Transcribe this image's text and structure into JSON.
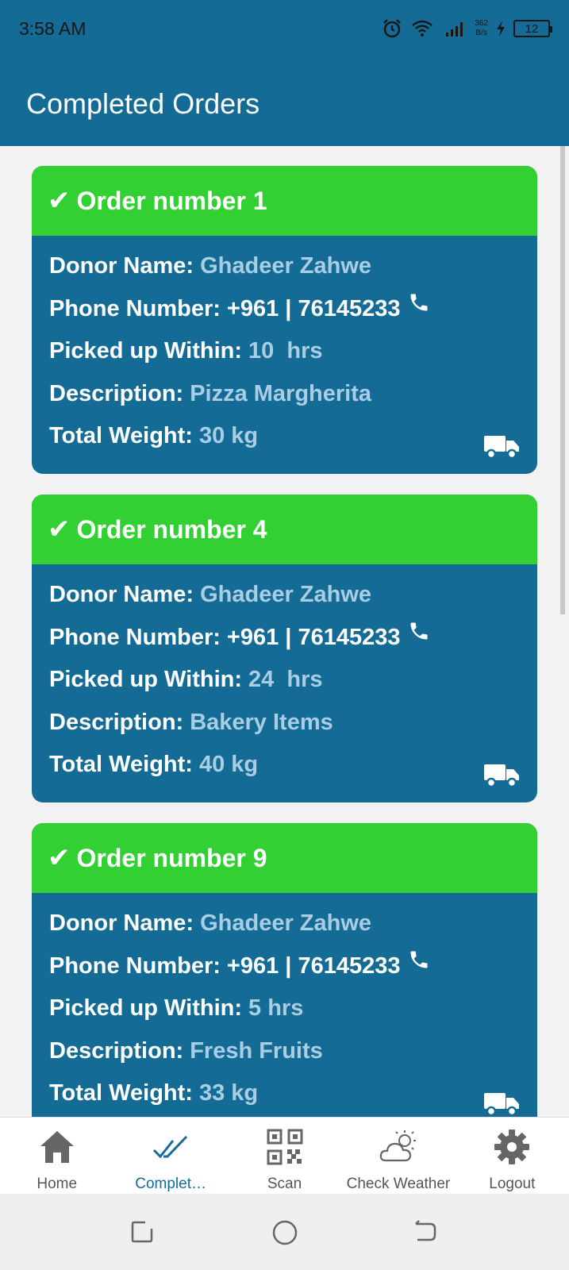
{
  "status_bar": {
    "time": "3:58 AM",
    "net_speed_value": "362",
    "net_speed_unit": "B/s",
    "battery": "12"
  },
  "header": {
    "title": "Completed Orders"
  },
  "orders": [
    {
      "title": "Order number 1",
      "donor_label": "Donor Name:",
      "donor": "Ghadeer Zahwe",
      "phone_label": "Phone Number:",
      "phone": "+961 | 76145233",
      "pickup_label": "Picked up Within:",
      "pickup": "10  hrs",
      "desc_label": "Description:",
      "desc": "Pizza Margherita",
      "weight_label": "Total Weight:",
      "weight": "30 kg"
    },
    {
      "title": "Order number 4",
      "donor_label": "Donor Name:",
      "donor": "Ghadeer Zahwe",
      "phone_label": "Phone Number:",
      "phone": "+961 | 76145233",
      "pickup_label": "Picked up Within:",
      "pickup": "24  hrs",
      "desc_label": "Description:",
      "desc": "Bakery Items",
      "weight_label": "Total Weight:",
      "weight": "40 kg"
    },
    {
      "title": "Order number 9",
      "donor_label": "Donor Name:",
      "donor": "Ghadeer Zahwe",
      "phone_label": "Phone Number:",
      "phone": "+961 | 76145233",
      "pickup_label": "Picked up Within:",
      "pickup": "5 hrs",
      "desc_label": "Description:",
      "desc": "Fresh Fruits",
      "weight_label": "Total Weight:",
      "weight": "33 kg"
    }
  ],
  "bottom_nav": [
    {
      "label": "Home",
      "icon": "home-icon"
    },
    {
      "label": "Complet…",
      "icon": "double-check-icon",
      "active": true
    },
    {
      "label": "Scan",
      "icon": "qr-code-icon"
    },
    {
      "label": "Check Weather",
      "icon": "weather-icon"
    },
    {
      "label": "Logout",
      "icon": "gear-icon"
    }
  ],
  "colors": {
    "primary": "#146c96",
    "header_green": "#33d033",
    "value_text": "#a9cde2"
  }
}
